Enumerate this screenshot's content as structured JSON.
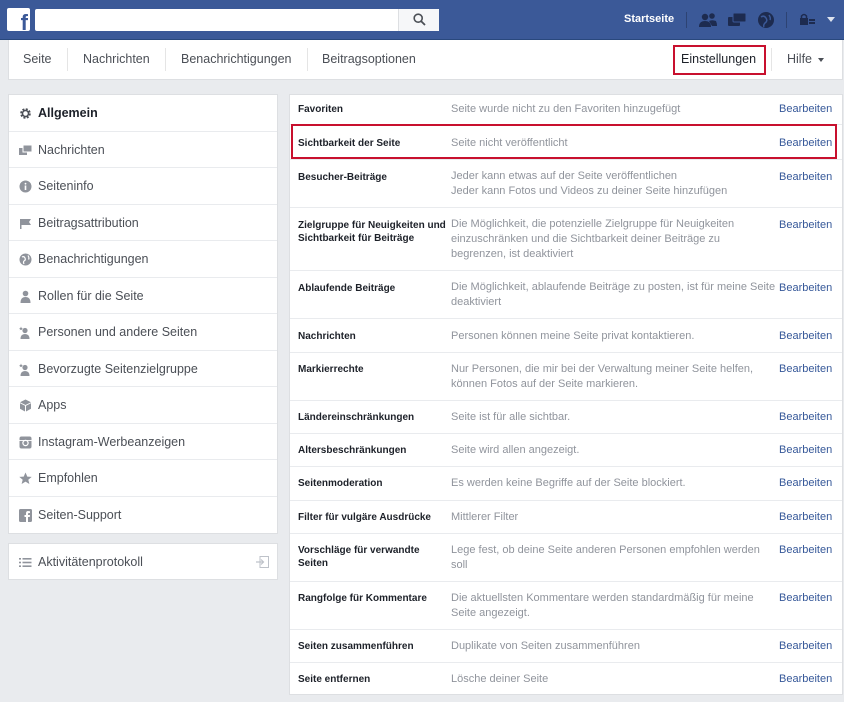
{
  "topbar": {
    "logo": "f",
    "search_placeholder": "",
    "home": "Startseite",
    "icons": [
      "friends-icon",
      "messages-icon",
      "notifications-globe-icon",
      "privacy-icon"
    ]
  },
  "tabs": [
    {
      "label": "Seite"
    },
    {
      "label": "Nachrichten"
    },
    {
      "label": "Benachrichtigungen"
    },
    {
      "label": "Beitragsoptionen"
    }
  ],
  "tabs_right": {
    "settings": "Einstellungen",
    "help": "Hilfe"
  },
  "leftnav": {
    "items": [
      {
        "label": "Allgemein",
        "icon": "gear-icon",
        "active": true
      },
      {
        "label": "Nachrichten",
        "icon": "messages-icon"
      },
      {
        "label": "Seiteninfo",
        "icon": "info-icon"
      },
      {
        "label": "Beitragsattribution",
        "icon": "flag-icon"
      },
      {
        "label": "Benachrichtigungen",
        "icon": "globe-icon"
      },
      {
        "label": "Rollen für die Seite",
        "icon": "person-icon"
      },
      {
        "label": "Personen und andere Seiten",
        "icon": "person-star-icon"
      },
      {
        "label": "Bevorzugte Seitenzielgruppe",
        "icon": "person-star-icon"
      },
      {
        "label": "Apps",
        "icon": "cube-icon"
      },
      {
        "label": "Instagram-Werbeanzeigen",
        "icon": "instagram-icon"
      },
      {
        "label": "Empfohlen",
        "icon": "star-icon"
      },
      {
        "label": "Seiten-Support",
        "icon": "facebook-icon"
      }
    ],
    "activity": {
      "label": "Aktivitätenprotokoll",
      "icon": "list-icon"
    }
  },
  "settings": {
    "edit_label": "Bearbeiten",
    "rows": [
      {
        "name": "Favoriten",
        "desc": "Seite wurde nicht zu den Favoriten hinzugefügt"
      },
      {
        "name": "Sichtbarkeit der Seite",
        "desc": "Seite nicht veröffentlicht"
      },
      {
        "name": "Besucher-Beiträge",
        "desc": "Jeder kann etwas auf der Seite veröffentlichen\nJeder kann Fotos und Videos zu deiner Seite hinzufügen"
      },
      {
        "name": "Zielgruppe für Neuigkeiten und Sichtbarkeit für Beiträge",
        "desc": "Die Möglichkeit, die potenzielle Zielgruppe für Neuigkeiten einzuschränken und die Sichtbarkeit deiner Beiträge zu begrenzen, ist deaktiviert"
      },
      {
        "name": "Ablaufende Beiträge",
        "desc": "Die Möglichkeit, ablaufende Beiträge zu posten, ist für meine Seite deaktiviert"
      },
      {
        "name": "Nachrichten",
        "desc": "Personen können meine Seite privat kontaktieren."
      },
      {
        "name": "Markierrechte",
        "desc": "Nur Personen, die mir bei der Verwaltung meiner Seite helfen, können Fotos auf der Seite markieren."
      },
      {
        "name": "Ländereinschränkungen",
        "desc": "Seite ist für alle sichtbar."
      },
      {
        "name": "Altersbeschränkungen",
        "desc": "Seite wird allen angezeigt."
      },
      {
        "name": "Seitenmoderation",
        "desc": "Es werden keine Begriffe auf der Seite blockiert."
      },
      {
        "name": "Filter für vulgäre Ausdrücke",
        "desc": "Mittlerer Filter"
      },
      {
        "name": "Vorschläge für verwandte Seiten",
        "desc": "Lege fest, ob deine Seite anderen Personen empfohlen werden soll"
      },
      {
        "name": "Rangfolge für Kommentare",
        "desc": "Die aktuellsten Kommentare werden standardmäßig für meine Seite angezeigt."
      },
      {
        "name": "Seiten zusammenführen",
        "desc": "Duplikate von Seiten zusammenführen"
      },
      {
        "name": "Seite entfernen",
        "desc": "Lösche deiner Seite"
      }
    ]
  }
}
